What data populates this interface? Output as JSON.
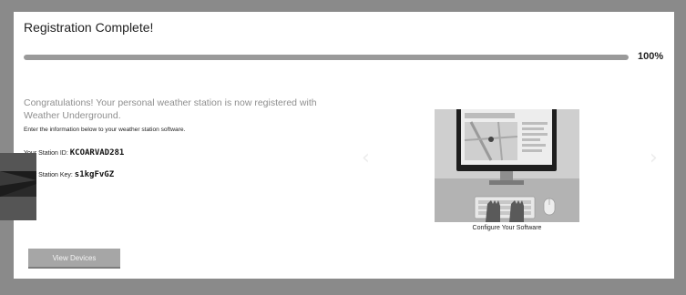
{
  "dialog": {
    "title": "Registration Complete!",
    "progress": {
      "percent": 100,
      "label": "100%"
    },
    "congrats_text": "Congratulations! Your personal weather station is now registered with Weather Underground.",
    "instruction_text": "Enter the information below to your weather station software.",
    "station_id": {
      "label": "Your Station ID:",
      "value": "KCOARVAD281"
    },
    "station_key": {
      "label": "Your Station Key:",
      "value": "s1kgFvGZ"
    },
    "view_devices_label": "View Devices",
    "carousel": {
      "caption": "Configure Your Software",
      "prev_icon": "chevron-left-icon",
      "next_icon": "chevron-right-icon"
    }
  },
  "colors": {
    "backdrop": "#8a8a8a",
    "panel": "#ffffff",
    "progress_fill": "#9a9a9a",
    "progress_track": "#dcdcdc",
    "button": "#a6a6a6",
    "muted_text": "#8f8f8f"
  }
}
